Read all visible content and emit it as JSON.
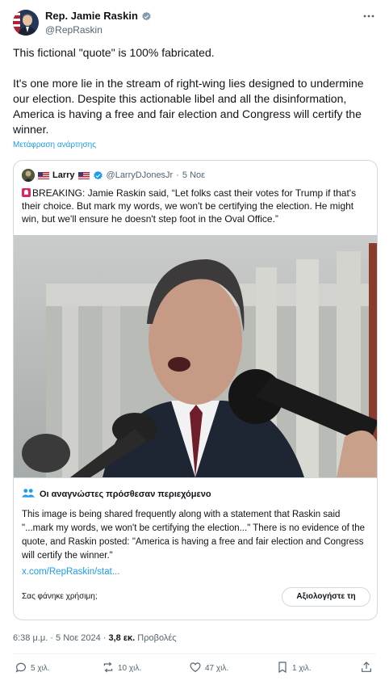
{
  "author": {
    "name": "Rep. Jamie Raskin",
    "handle": "@RepRaskin"
  },
  "tweet": {
    "text": "This fictional \"quote\" is 100% fabricated.\n\nIt's one more lie in the stream of right-wing lies designed to undermine our election. Despite this actionable libel and all the disinformation, America is having a free and fair election and Congress will certify the winner.",
    "translate_label": "Μετάφραση ανάρτησης"
  },
  "quoted": {
    "name": "Larry",
    "handle": "@LarryDJonesJr",
    "separator": "·",
    "time": "5 Νοε",
    "text": "BREAKING: Jamie Raskin said, “Let folks cast their votes for Trump if that's their choice. But mark my words, we won't be certifying the election. He might win, but we'll ensure he doesn't step foot in the Oval Office.”"
  },
  "community_note": {
    "title": "Οι αναγνώστες πρόσθεσαν περιεχόμενο",
    "body": "This image is being shared frequently along with a statement that Raskin said \"...mark my words, we won't be certifying the election...\" There is no evidence of the quote, and Raskin posted: \"America is having a free and fair election and Congress will certify the winner.\"",
    "link": "x.com/RepRaskin/stat...",
    "helpful_prompt": "Σας φάνηκε χρήσιμη;",
    "rate_button": "Αξιολογήστε τη"
  },
  "meta": {
    "timestamp": "6:38 μ.μ. · 5 Νοε 2024 · ",
    "views_count": "3,8 εκ.",
    "views_label": " Προβολές"
  },
  "actions": {
    "replies": "5 χιλ.",
    "reposts": "10 χιλ.",
    "likes": "47 χιλ.",
    "bookmarks": "1 χιλ."
  },
  "colors": {
    "accent": "#1d9bf0",
    "text": "#0f1419",
    "muted": "#536471",
    "border": "#cfd9de"
  }
}
